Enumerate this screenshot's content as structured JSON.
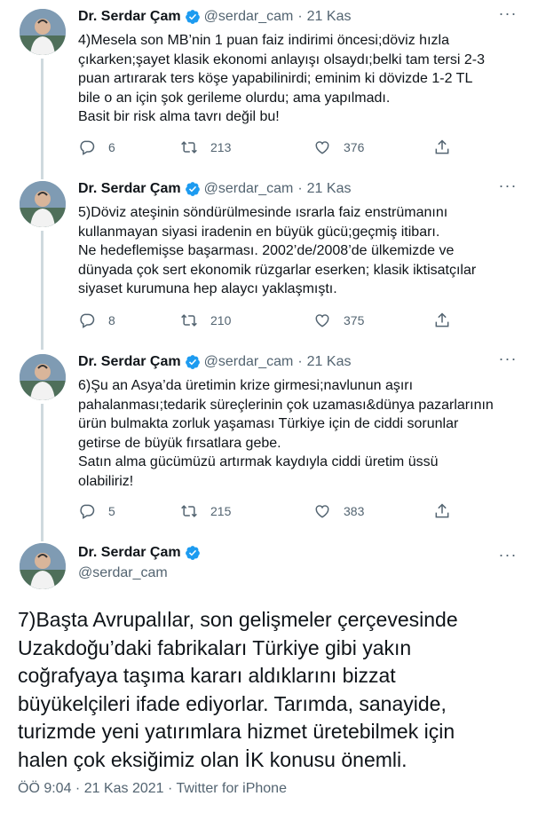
{
  "colors": {
    "accent": "#1d9bf0",
    "text": "#0f1419",
    "muted": "#536471",
    "line": "#cfd9de"
  },
  "tweets": [
    {
      "name": "Dr. Serdar Çam",
      "handle": "@serdar_cam",
      "date": "21 Kas",
      "text": "4)Mesela son MB’nin 1 puan faiz indirimi öncesi;döviz hızla\nçıkarken;şayet klasik ekonomi anlayışı olsaydı;belki tam tersi 2-3\npuan  artırarak ters köşe yapabilinirdi; eminim ki dövizde 1-2 TL\nbile o an için şok gerileme olurdu; ama yapılmadı.\nBasit bir risk alma tavrı değil bu!",
      "replies": "6",
      "retweets": "213",
      "likes": "376"
    },
    {
      "name": "Dr. Serdar Çam",
      "handle": "@serdar_cam",
      "date": "21 Kas",
      "text": "5)Döviz ateşinin söndürülmesinde ısrarla faiz enstrümanını\nkullanmayan siyasi iradenin en büyük gücü;geçmiş itibarı.\nNe hedeflemişse başarması. 2002’de/2008’de ülkemizde ve\ndünyada çok sert ekonomik rüzgarlar eserken; klasik iktisatçılar\nsiyaset kurumuna hep alaycı yaklaşmıştı.",
      "replies": "8",
      "retweets": "210",
      "likes": "375"
    },
    {
      "name": "Dr. Serdar Çam",
      "handle": "@serdar_cam",
      "date": "21 Kas",
      "text": "6)Şu an Asya’da üretimin krize girmesi;navlunun aşırı\npahalanması;tedarik süreçlerinin çok uzaması&dünya pazarlarının\nürün bulmakta zorluk yaşaması Türkiye için de ciddi sorunlar\ngetirse de büyük fırsatlara gebe.\nSatın alma gücümüzü artırmak kaydıyla ciddi üretim üssü\nolabiliriz!",
      "replies": "5",
      "retweets": "215",
      "likes": "383"
    }
  ],
  "main_tweet": {
    "name": "Dr. Serdar Çam",
    "handle": "@serdar_cam",
    "text": "7)Başta Avrupalılar, son gelişmeler çerçevesinde\nUzakdoğu’daki fabrikaları Türkiye gibi yakın\ncoğrafyaya taşıma kararı aldıklarını bizzat\nbüyükelçileri ifade ediyorlar. Tarımda, sanayide,\nturizmde yeni yatırımlara hizmet üretebilmek için\nhalen çok eksiğimiz olan İK konusu önemli.",
    "meta": "ÖÖ 9:04 · 21 Kas 2021 · Twitter for iPhone"
  },
  "icons": {
    "verified": "verified-badge-icon",
    "more": "more-options-icon",
    "reply": "reply-icon",
    "retweet": "retweet-icon",
    "like": "like-icon",
    "share": "share-icon"
  }
}
